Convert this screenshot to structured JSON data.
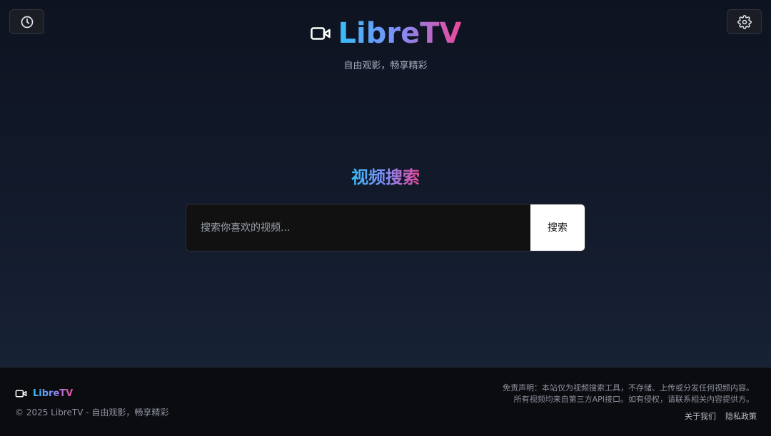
{
  "header": {
    "history_icon": "clock-icon",
    "settings_icon": "gear-icon",
    "logo_icon": "video-camera-icon",
    "logo_text": "LibreTV",
    "tagline": "自由观影，畅享精彩"
  },
  "search": {
    "title": "视频搜索",
    "placeholder": "搜索你喜欢的视频...",
    "value": "",
    "button_label": "搜索"
  },
  "footer": {
    "logo_icon": "video-camera-icon",
    "logo_text": "LibreTV",
    "copyright": "© 2025 LibreTV - 自由观影，畅享精彩",
    "disclaimer_line1": "免责声明：本站仅为视频搜索工具，不存储、上传或分发任何视频内容。",
    "disclaimer_line2": "所有视频均来自第三方API接口。如有侵权，请联系相关内容提供方。",
    "links": [
      {
        "label": "关于我们"
      },
      {
        "label": "隐私政策"
      }
    ]
  },
  "colors": {
    "gradient_start": "#38bdf8",
    "gradient_mid": "#818cf8",
    "gradient_end": "#ec4899",
    "background": "#121a2b"
  }
}
